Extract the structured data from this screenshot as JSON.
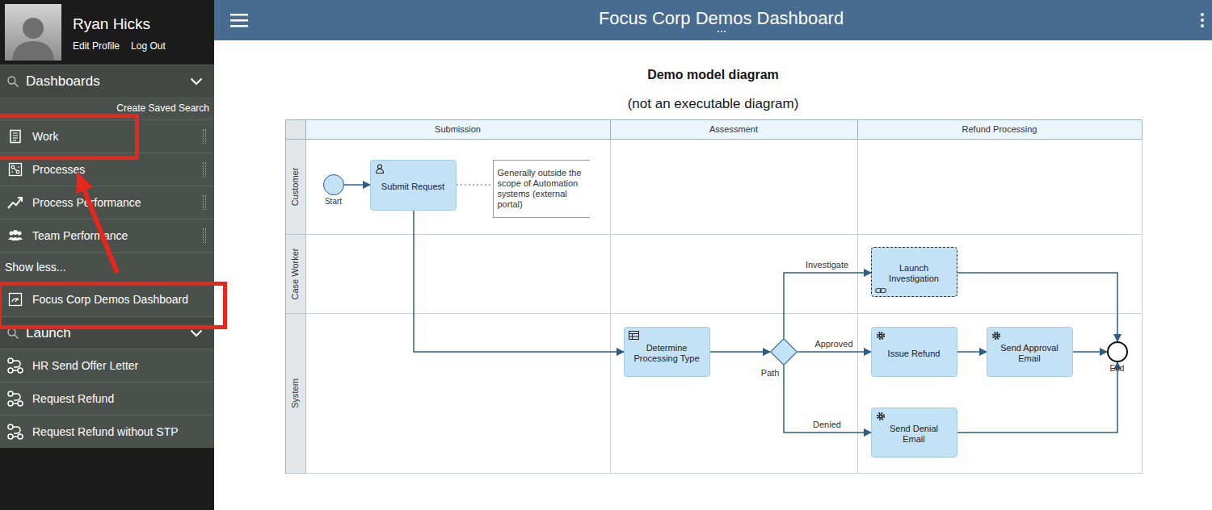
{
  "user": {
    "name": "Ryan Hicks",
    "links": [
      "Edit Profile",
      "Log Out"
    ]
  },
  "sidebar": {
    "sections": [
      {
        "title": "Dashboards",
        "expanded": true,
        "action": "Create Saved Search",
        "items": [
          {
            "label": "Work",
            "kind": "work",
            "annotated": true
          },
          {
            "label": "Processes",
            "kind": "processes",
            "annotated": false
          },
          {
            "label": "Process Performance",
            "kind": "performance",
            "annotated": false
          },
          {
            "label": "Team Performance",
            "kind": "team",
            "annotated": false
          }
        ],
        "toggle": "Show less...",
        "extra": [
          {
            "label": "Focus Corp Demos Dashboard",
            "kind": "dashboard",
            "annotated": true
          }
        ]
      },
      {
        "title": "Launch",
        "expanded": true,
        "items": [
          {
            "label": "HR Send Offer Letter",
            "kind": "process",
            "annotated": false
          },
          {
            "label": "Request Refund",
            "kind": "process",
            "annotated": false
          },
          {
            "label": "Request Refund without STP",
            "kind": "process",
            "annotated": false
          }
        ]
      }
    ]
  },
  "header": {
    "title": "Focus Corp Demos Dashboard"
  },
  "diagram": {
    "title": "Demo model diagram",
    "subtitle": "(not an executable diagram)",
    "phases": [
      "Submission",
      "Assessment",
      "Refund Processing"
    ],
    "lanes": [
      "Customer",
      "Case Worker",
      "System"
    ],
    "nodes": [
      {
        "kind": "start",
        "label": "Start"
      },
      {
        "kind": "user",
        "label": "Submit Request"
      },
      {
        "kind": "annotation",
        "label": "Generally outside the scope of Automation systems (external portal)"
      },
      {
        "kind": "rule",
        "label": "Determine Processing Type"
      },
      {
        "kind": "gateway",
        "label": "Path"
      },
      {
        "kind": "subprocess",
        "label": "Launch Investigation"
      },
      {
        "kind": "service",
        "label": "Issue Refund"
      },
      {
        "kind": "service",
        "label": "Send Approval Email"
      },
      {
        "kind": "service",
        "label": "Send Denial Email"
      },
      {
        "kind": "end",
        "label": "End"
      }
    ],
    "flows": [
      {
        "from": 0,
        "to": 1,
        "kind": "sequence"
      },
      {
        "from": 1,
        "to": 2,
        "kind": "association"
      },
      {
        "from": 1,
        "to": 3,
        "kind": "sequence"
      },
      {
        "from": 3,
        "to": 4,
        "kind": "sequence"
      },
      {
        "from": 4,
        "to": 5,
        "kind": "sequence",
        "label": "Investigate"
      },
      {
        "from": 4,
        "to": 6,
        "kind": "sequence",
        "label": "Approved"
      },
      {
        "from": 4,
        "to": 8,
        "kind": "sequence",
        "label": "Denied"
      },
      {
        "from": 6,
        "to": 7,
        "kind": "sequence"
      },
      {
        "from": 7,
        "to": 9,
        "kind": "sequence"
      },
      {
        "from": 5,
        "to": 9,
        "kind": "sequence"
      },
      {
        "from": 8,
        "to": 9,
        "kind": "sequence"
      }
    ]
  }
}
